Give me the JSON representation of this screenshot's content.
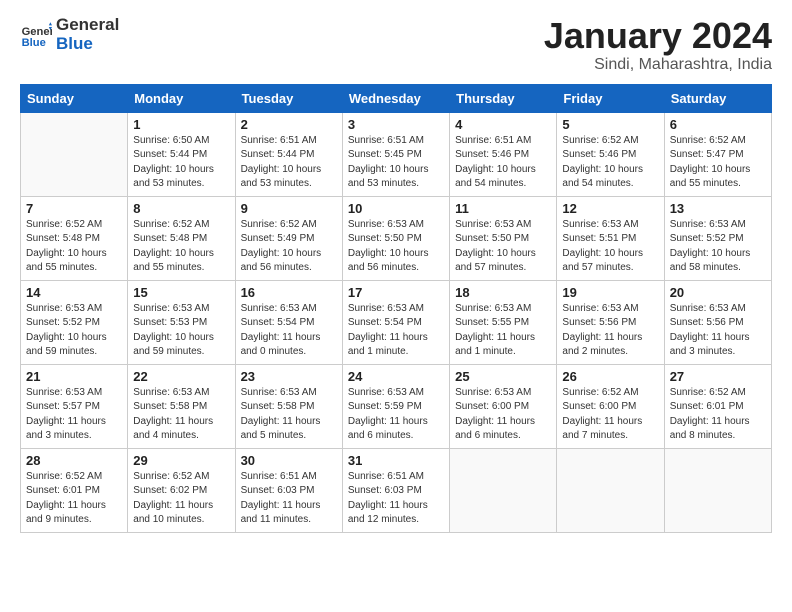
{
  "header": {
    "logo_general": "General",
    "logo_blue": "Blue",
    "main_title": "January 2024",
    "subtitle": "Sindi, Maharashtra, India"
  },
  "weekdays": [
    "Sunday",
    "Monday",
    "Tuesday",
    "Wednesday",
    "Thursday",
    "Friday",
    "Saturday"
  ],
  "weeks": [
    [
      {
        "day": "",
        "info": ""
      },
      {
        "day": "1",
        "info": "Sunrise: 6:50 AM\nSunset: 5:44 PM\nDaylight: 10 hours\nand 53 minutes."
      },
      {
        "day": "2",
        "info": "Sunrise: 6:51 AM\nSunset: 5:44 PM\nDaylight: 10 hours\nand 53 minutes."
      },
      {
        "day": "3",
        "info": "Sunrise: 6:51 AM\nSunset: 5:45 PM\nDaylight: 10 hours\nand 53 minutes."
      },
      {
        "day": "4",
        "info": "Sunrise: 6:51 AM\nSunset: 5:46 PM\nDaylight: 10 hours\nand 54 minutes."
      },
      {
        "day": "5",
        "info": "Sunrise: 6:52 AM\nSunset: 5:46 PM\nDaylight: 10 hours\nand 54 minutes."
      },
      {
        "day": "6",
        "info": "Sunrise: 6:52 AM\nSunset: 5:47 PM\nDaylight: 10 hours\nand 55 minutes."
      }
    ],
    [
      {
        "day": "7",
        "info": "Sunrise: 6:52 AM\nSunset: 5:48 PM\nDaylight: 10 hours\nand 55 minutes."
      },
      {
        "day": "8",
        "info": "Sunrise: 6:52 AM\nSunset: 5:48 PM\nDaylight: 10 hours\nand 55 minutes."
      },
      {
        "day": "9",
        "info": "Sunrise: 6:52 AM\nSunset: 5:49 PM\nDaylight: 10 hours\nand 56 minutes."
      },
      {
        "day": "10",
        "info": "Sunrise: 6:53 AM\nSunset: 5:50 PM\nDaylight: 10 hours\nand 56 minutes."
      },
      {
        "day": "11",
        "info": "Sunrise: 6:53 AM\nSunset: 5:50 PM\nDaylight: 10 hours\nand 57 minutes."
      },
      {
        "day": "12",
        "info": "Sunrise: 6:53 AM\nSunset: 5:51 PM\nDaylight: 10 hours\nand 57 minutes."
      },
      {
        "day": "13",
        "info": "Sunrise: 6:53 AM\nSunset: 5:52 PM\nDaylight: 10 hours\nand 58 minutes."
      }
    ],
    [
      {
        "day": "14",
        "info": "Sunrise: 6:53 AM\nSunset: 5:52 PM\nDaylight: 10 hours\nand 59 minutes."
      },
      {
        "day": "15",
        "info": "Sunrise: 6:53 AM\nSunset: 5:53 PM\nDaylight: 10 hours\nand 59 minutes."
      },
      {
        "day": "16",
        "info": "Sunrise: 6:53 AM\nSunset: 5:54 PM\nDaylight: 11 hours\nand 0 minutes."
      },
      {
        "day": "17",
        "info": "Sunrise: 6:53 AM\nSunset: 5:54 PM\nDaylight: 11 hours\nand 1 minute."
      },
      {
        "day": "18",
        "info": "Sunrise: 6:53 AM\nSunset: 5:55 PM\nDaylight: 11 hours\nand 1 minute."
      },
      {
        "day": "19",
        "info": "Sunrise: 6:53 AM\nSunset: 5:56 PM\nDaylight: 11 hours\nand 2 minutes."
      },
      {
        "day": "20",
        "info": "Sunrise: 6:53 AM\nSunset: 5:56 PM\nDaylight: 11 hours\nand 3 minutes."
      }
    ],
    [
      {
        "day": "21",
        "info": "Sunrise: 6:53 AM\nSunset: 5:57 PM\nDaylight: 11 hours\nand 3 minutes."
      },
      {
        "day": "22",
        "info": "Sunrise: 6:53 AM\nSunset: 5:58 PM\nDaylight: 11 hours\nand 4 minutes."
      },
      {
        "day": "23",
        "info": "Sunrise: 6:53 AM\nSunset: 5:58 PM\nDaylight: 11 hours\nand 5 minutes."
      },
      {
        "day": "24",
        "info": "Sunrise: 6:53 AM\nSunset: 5:59 PM\nDaylight: 11 hours\nand 6 minutes."
      },
      {
        "day": "25",
        "info": "Sunrise: 6:53 AM\nSunset: 6:00 PM\nDaylight: 11 hours\nand 6 minutes."
      },
      {
        "day": "26",
        "info": "Sunrise: 6:52 AM\nSunset: 6:00 PM\nDaylight: 11 hours\nand 7 minutes."
      },
      {
        "day": "27",
        "info": "Sunrise: 6:52 AM\nSunset: 6:01 PM\nDaylight: 11 hours\nand 8 minutes."
      }
    ],
    [
      {
        "day": "28",
        "info": "Sunrise: 6:52 AM\nSunset: 6:01 PM\nDaylight: 11 hours\nand 9 minutes."
      },
      {
        "day": "29",
        "info": "Sunrise: 6:52 AM\nSunset: 6:02 PM\nDaylight: 11 hours\nand 10 minutes."
      },
      {
        "day": "30",
        "info": "Sunrise: 6:51 AM\nSunset: 6:03 PM\nDaylight: 11 hours\nand 11 minutes."
      },
      {
        "day": "31",
        "info": "Sunrise: 6:51 AM\nSunset: 6:03 PM\nDaylight: 11 hours\nand 12 minutes."
      },
      {
        "day": "",
        "info": ""
      },
      {
        "day": "",
        "info": ""
      },
      {
        "day": "",
        "info": ""
      }
    ]
  ]
}
